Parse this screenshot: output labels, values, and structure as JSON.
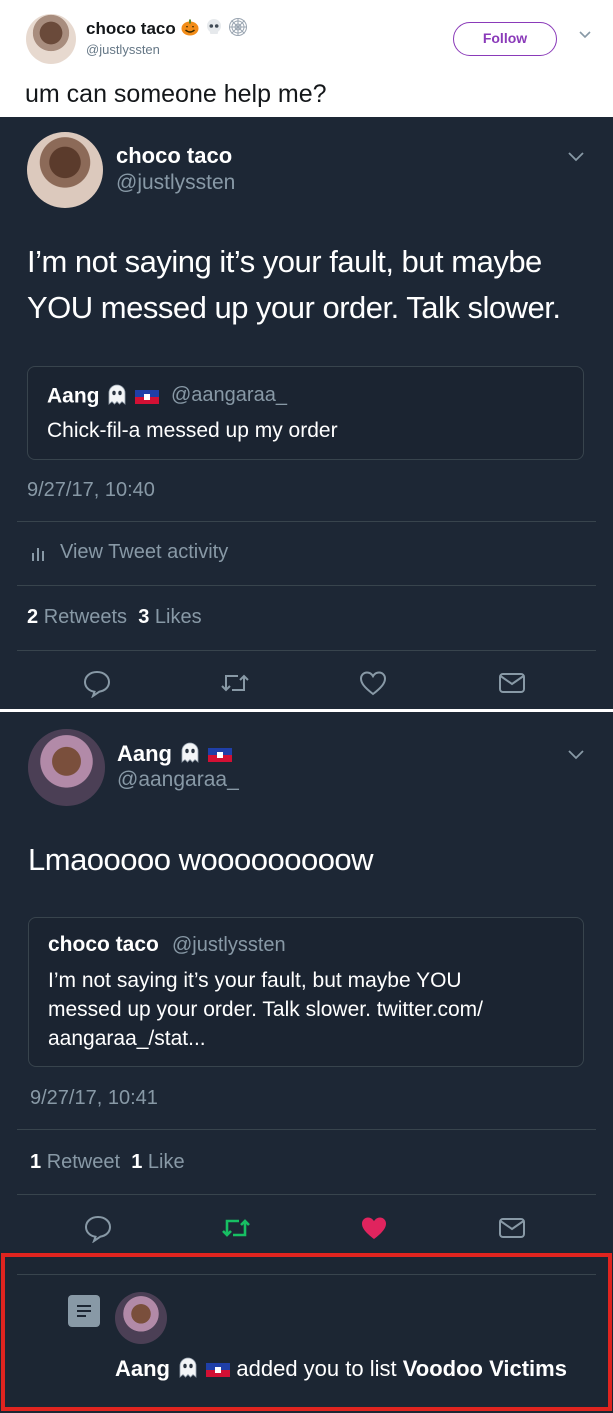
{
  "header": {
    "name": "choco taco",
    "handle": "@justlyssten",
    "follow_label": "Follow",
    "text": "um can someone help me?"
  },
  "tweet1": {
    "name": "choco taco",
    "handle": "@justlyssten",
    "line1": "I’m not saying it’s your fault, but maybe",
    "line2": "YOU messed up your order. Talk slower.",
    "quote": {
      "name": "Aang",
      "handle": "@aangaraa_",
      "text": "Chick-fil-a messed up my order"
    },
    "timestamp": "9/27/17, 10:40",
    "activity_label": "View Tweet activity",
    "retweets_count": "2",
    "retweets_label": "Retweets",
    "likes_count": "3",
    "likes_label": "Likes"
  },
  "tweet2": {
    "name": "Aang",
    "handle": "@aangaraa_",
    "text": "Lmaooooo wooooooooow",
    "quote": {
      "name": "choco taco",
      "handle": "@justlyssten",
      "line1": "I’m not saying it’s your fault, but maybe YOU",
      "line2": "messed up your order. Talk slower. twitter.com/",
      "line3": "aangaraa_/stat..."
    },
    "timestamp": "9/27/17, 10:41",
    "retweets_count": "1",
    "retweets_label": "Retweet",
    "likes_count": "1",
    "likes_label": "Like"
  },
  "notification": {
    "name": "Aang",
    "action": "added you to list",
    "list_name": "Voodoo Victims"
  },
  "colors": {
    "panel": "#1d2735",
    "accent_purple": "#8a3ab9",
    "retweet_green": "#17bf63",
    "like_red": "#e0245e",
    "highlight_red": "#e0241f"
  },
  "icons": [
    "pumpkin-icon",
    "skull-icon",
    "spiderweb-icon",
    "ghost-icon",
    "haiti-flag-icon",
    "reply-icon",
    "retweet-icon",
    "like-icon",
    "dm-icon",
    "chart-icon",
    "list-icon",
    "chevron-down-icon"
  ]
}
